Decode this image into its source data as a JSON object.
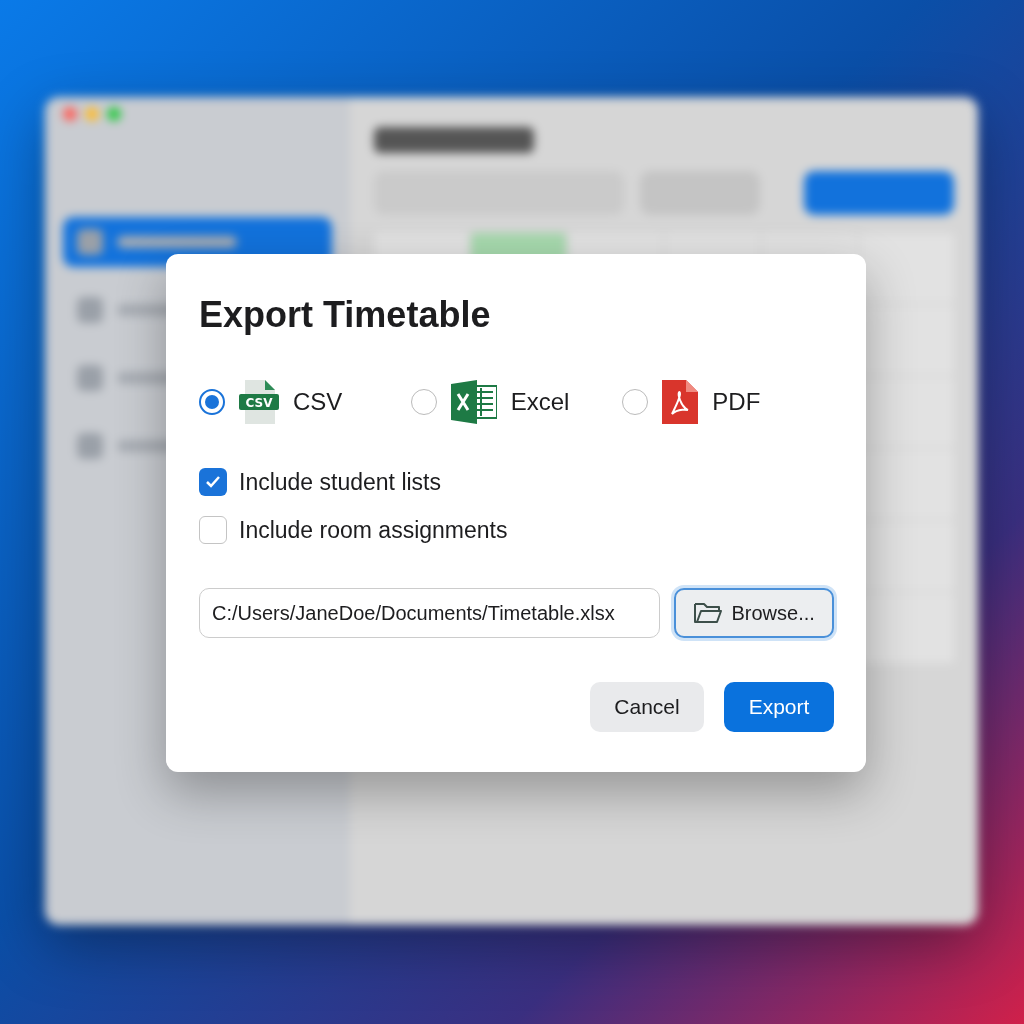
{
  "dialog": {
    "title": "Export Timetable",
    "formats": [
      {
        "kind": "csv",
        "label": "CSV",
        "icon_text": "CSV",
        "selected": true
      },
      {
        "kind": "excel",
        "label": "Excel",
        "selected": false
      },
      {
        "kind": "pdf",
        "label": "PDF",
        "selected": false
      }
    ],
    "options": [
      {
        "label": "Include student lists",
        "checked": true
      },
      {
        "label": "Include room assignments",
        "checked": false
      }
    ],
    "path_field": {
      "value": "C:/Users/JaneDoe/Documents/Timetable.xlsx"
    },
    "browse_button": "Browse...",
    "buttons": [
      {
        "kind": "secondary",
        "label": "Cancel"
      },
      {
        "kind": "primary",
        "label": "Export"
      }
    ]
  }
}
